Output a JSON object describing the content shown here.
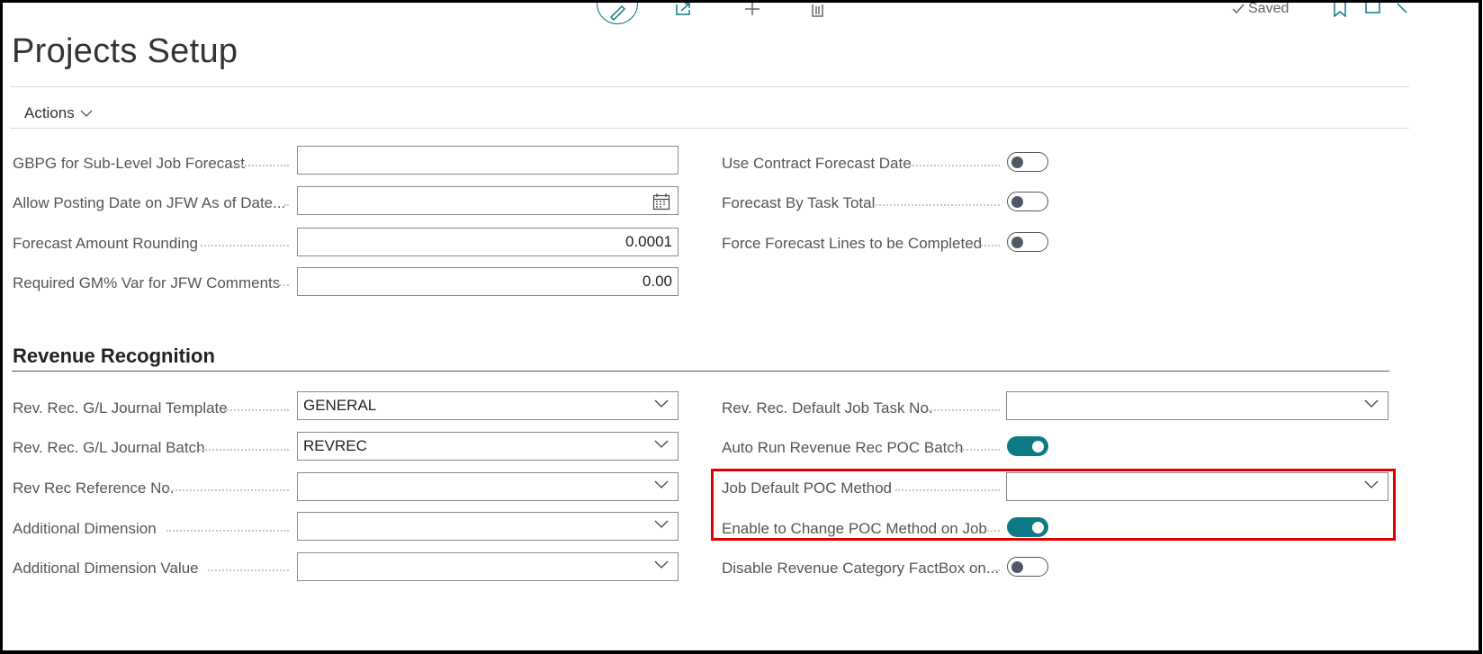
{
  "header": {
    "title": "Projects Setup",
    "saved_label": "Saved",
    "actions_label": "Actions"
  },
  "forecast_fields_left": [
    {
      "label": "GBPG for Sub-Level Job Forecast",
      "value": ""
    },
    {
      "label": "Allow Posting Date on JFW As of Date...",
      "value": ""
    },
    {
      "label": "Forecast Amount Rounding",
      "value": "0.0001"
    },
    {
      "label": "Required GM% Var for JFW Comments",
      "value": "0.00"
    }
  ],
  "forecast_fields_right": [
    {
      "label": "Use Contract Forecast Date",
      "state": "off"
    },
    {
      "label": "Forecast By Task Total",
      "state": "off"
    },
    {
      "label": "Force Forecast Lines to be Completed",
      "state": "off"
    }
  ],
  "revenue_section": {
    "title": "Revenue Recognition",
    "left": [
      {
        "label": "Rev. Rec. G/L Journal Template",
        "value": "GENERAL"
      },
      {
        "label": "Rev. Rec. G/L Journal Batch",
        "value": "REVREC"
      },
      {
        "label": "Rev Rec Reference No.",
        "value": ""
      },
      {
        "label": "Additional Dimension",
        "value": ""
      },
      {
        "label": "Additional Dimension Value",
        "value": ""
      }
    ],
    "right": [
      {
        "label": "Rev. Rec. Default Job Task No.",
        "value": ""
      },
      {
        "label": "Auto Run Revenue Rec POC Batch",
        "state": "on"
      },
      {
        "label": "Job Default POC Method",
        "value": ""
      },
      {
        "label": "Enable to Change POC Method on Job",
        "state": "on"
      },
      {
        "label": "Disable Revenue Category FactBox on...",
        "state": "off"
      }
    ]
  },
  "colors": {
    "toggle_on": "#0e7a86",
    "highlight": "#e00000"
  }
}
